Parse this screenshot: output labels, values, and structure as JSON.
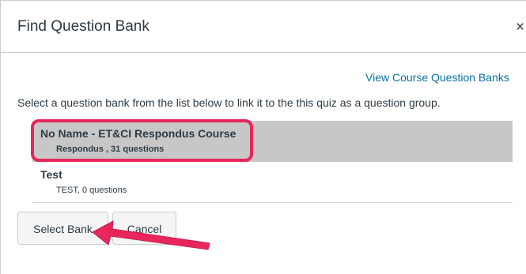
{
  "dialog": {
    "title": "Find Question Bank",
    "close_glyph": "×",
    "view_link": "View Course Question Banks",
    "instructions": "Select a question bank from the list below to link it to the this quiz as a question group."
  },
  "banks": [
    {
      "title": "No Name - ET&CI Respondus Course",
      "subtitle": "Respondus , 31 questions",
      "selected": true
    },
    {
      "title": "Test",
      "subtitle": "TEST, 0 questions",
      "selected": false
    }
  ],
  "buttons": {
    "select_label": "Select Bank",
    "cancel_label": "Cancel"
  },
  "annotation": {
    "highlight_color": "#e8265b",
    "arrow_color": "#e8265b"
  },
  "colors": {
    "link": "#0770a3",
    "selected_row": "#c7c7c7",
    "text": "#2d3b45"
  }
}
